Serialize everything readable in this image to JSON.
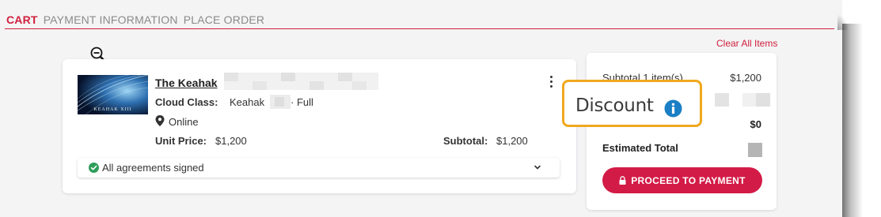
{
  "tabs": {
    "cart": "CART",
    "payment": "PAYMENT INFORMATION",
    "place_order": "PLACE ORDER"
  },
  "clear_all": "Clear All Items",
  "item": {
    "title": "The Keahak",
    "thumbnail_text": "KEAHAK XIII",
    "class_label": "Cloud Class:",
    "class_value": "Keahak",
    "class_tail": "· Full",
    "location": "Online",
    "unit_price_label": "Unit Price:",
    "unit_price": "$1,200",
    "subtotal_label": "Subtotal:",
    "subtotal": "$1,200",
    "agreements": "All agreements signed"
  },
  "summary": {
    "subtotal_label": "Subtotal 1 item(s)",
    "subtotal_value": "$1,200",
    "zero_value": "$0",
    "estimated_total_label": "Estimated Total",
    "proceed_label": "PROCEED TO PAYMENT"
  },
  "callout": {
    "label": "Discount"
  },
  "colors": {
    "accent": "#d01f3c",
    "button": "#d31b47",
    "highlight_border": "#f0a81e",
    "info_blue": "#1a7fc4",
    "check_green": "#2e9e5b"
  },
  "icons": [
    "zoom-out-icon",
    "location-pin-icon",
    "check-circle-icon",
    "chevron-down-icon",
    "kebab-menu-icon",
    "lock-icon",
    "info-icon"
  ]
}
